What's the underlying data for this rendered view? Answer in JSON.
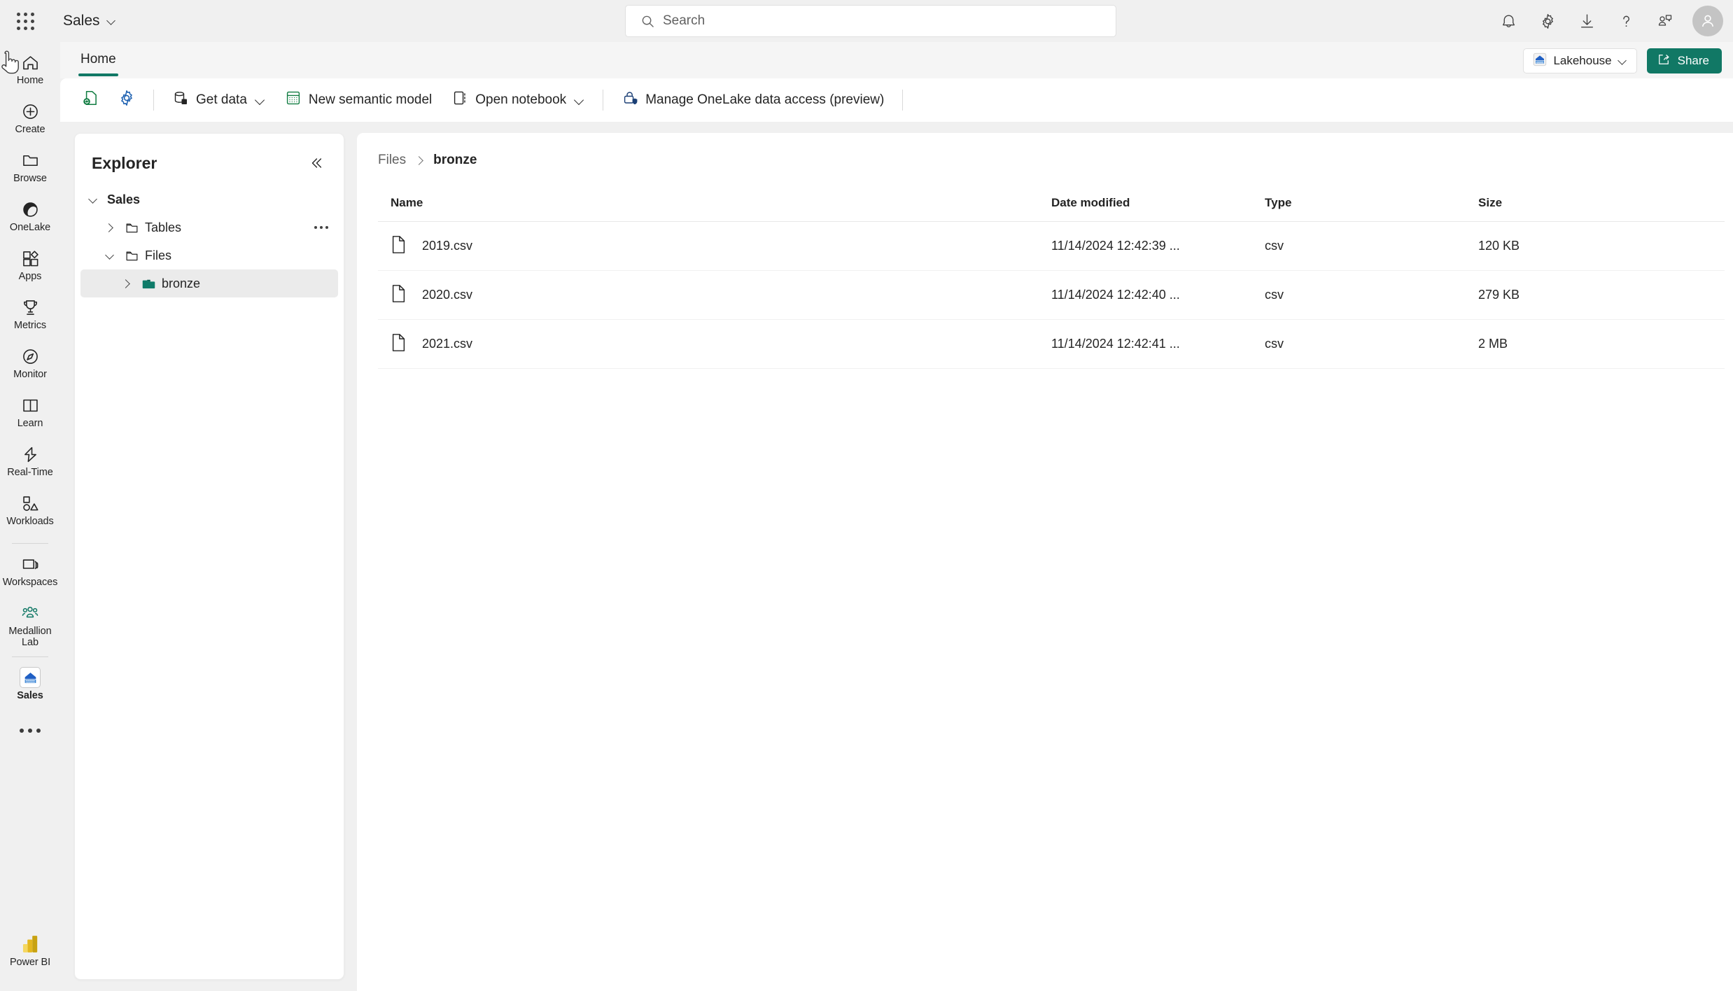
{
  "topbar": {
    "waffle_label": "App launcher",
    "brand": "Sales",
    "search": {
      "placeholder": "Search"
    },
    "icons": [
      {
        "name": "notifications-icon",
        "label": "Notifications"
      },
      {
        "name": "settings-gear-icon",
        "label": "Settings"
      },
      {
        "name": "download-icon",
        "label": "Downloads"
      },
      {
        "name": "help-icon",
        "label": "Help"
      },
      {
        "name": "feedback-icon",
        "label": "Feedback"
      }
    ],
    "avatar_label": "Account manager"
  },
  "rail": {
    "items": [
      {
        "label": "Home",
        "icon": "home-icon",
        "active": false
      },
      {
        "label": "Create",
        "icon": "create-plus-icon",
        "active": false
      },
      {
        "label": "Browse",
        "icon": "browse-folder-icon",
        "active": false
      },
      {
        "label": "OneLake",
        "icon": "onelake-icon",
        "active": false
      },
      {
        "label": "Apps",
        "icon": "apps-icon",
        "active": false
      },
      {
        "label": "Metrics",
        "icon": "metrics-trophy-icon",
        "active": false
      },
      {
        "label": "Monitor",
        "icon": "monitor-icon",
        "active": false
      },
      {
        "label": "Learn",
        "icon": "learn-book-icon",
        "active": false
      },
      {
        "label": "Real-Time",
        "icon": "real-time-bolt-icon",
        "active": false
      },
      {
        "label": "Workloads",
        "icon": "workloads-icon",
        "active": false
      }
    ],
    "items2": [
      {
        "label": "Workspaces",
        "icon": "workspaces-icon",
        "active": false
      },
      {
        "label": "Medallion Lab",
        "icon": "medallion-lab-people-icon",
        "active": false
      }
    ],
    "items3": [
      {
        "label": "Sales",
        "icon": "lakehouse-icon",
        "active": true
      }
    ],
    "more_label": "More options",
    "powerbi": {
      "label": "Power BI",
      "icon": "power-bi-icon"
    }
  },
  "header": {
    "tabs": [
      {
        "label": "Home",
        "active": true
      }
    ],
    "item_type_button": {
      "label": "Lakehouse",
      "icon": "lakehouse-icon"
    },
    "share_button": {
      "label": "Share",
      "icon": "share-icon"
    }
  },
  "ribbon": {
    "refresh_label": "Refresh",
    "settings_label": "Settings",
    "buttons": [
      {
        "label": "Get data",
        "icon": "get-data-icon",
        "caret": true
      },
      {
        "label": "New semantic model",
        "icon": "semantic-model-icon",
        "caret": false
      },
      {
        "label": "Open notebook",
        "icon": "notebook-icon",
        "caret": true
      },
      {
        "label": "Manage OneLake data access (preview)",
        "icon": "onelake-access-lock-icon",
        "caret": false
      }
    ]
  },
  "explorer": {
    "title": "Explorer",
    "collapse_label": "Collapse",
    "tree": [
      {
        "label": "Sales",
        "level": 0,
        "twisty": "down",
        "icon": null,
        "bold": true,
        "selected": false,
        "ellipsis": false
      },
      {
        "label": "Tables",
        "level": 1,
        "twisty": "right",
        "icon": "folder-outline-icon",
        "bold": false,
        "selected": false,
        "ellipsis": true
      },
      {
        "label": "Files",
        "level": 1,
        "twisty": "down",
        "icon": "folder-outline-icon",
        "bold": false,
        "selected": false,
        "ellipsis": false
      },
      {
        "label": "bronze",
        "level": 2,
        "twisty": "right",
        "icon": "folder-filled-icon",
        "bold": false,
        "selected": true,
        "ellipsis": false
      }
    ]
  },
  "main": {
    "breadcrumb": [
      {
        "label": "Files",
        "current": false
      },
      {
        "label": "bronze",
        "current": true
      }
    ],
    "columns": [
      "Name",
      "Date modified",
      "Type",
      "Size"
    ],
    "rows": [
      {
        "icon": "file-icon",
        "name": "2019.csv",
        "date": "11/14/2024 12:42:39 ...",
        "type": "csv",
        "size": "120 KB"
      },
      {
        "icon": "file-icon",
        "name": "2020.csv",
        "date": "11/14/2024 12:42:40 ...",
        "type": "csv",
        "size": "279 KB"
      },
      {
        "icon": "file-icon",
        "name": "2021.csv",
        "date": "11/14/2024 12:42:41 ...",
        "type": "csv",
        "size": "2 MB"
      }
    ]
  },
  "colors": {
    "accent_teal": "#117865",
    "brand_blue": "#1b5fb0",
    "green": "#107c41",
    "page_bg": "#f0f0f0",
    "selected_row": "#ebebeb"
  }
}
